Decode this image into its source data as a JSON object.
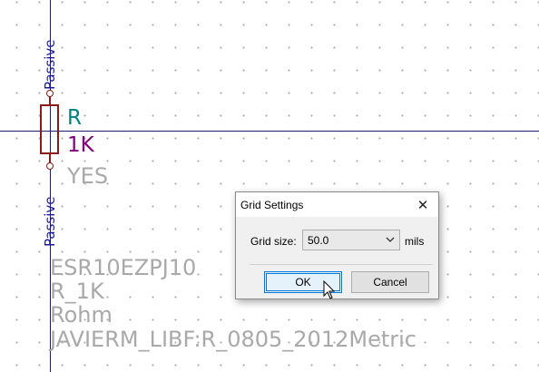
{
  "schematic": {
    "pin_top_label": "Passive",
    "pin_bottom_label": "Passive",
    "reference": "R",
    "value": "1K",
    "field_yes": "YES",
    "field_mpn": "ESR10EZPJ10",
    "field_name": "R_1K",
    "field_manufacturer": "Rohm",
    "field_footprint": "JAVIERM_LIBF:R_0805_2012Metric",
    "colors": {
      "wire": "#1c1c6e",
      "body": "#8b1a1a",
      "pin_label": "#1a1a99",
      "reference": "#008080",
      "value": "#800080",
      "field": "#a9a9a9"
    }
  },
  "dialog": {
    "title": "Grid Settings",
    "grid_size_label": "Grid size:",
    "grid_size_value": "50.0",
    "unit": "mils",
    "ok_label": "OK",
    "cancel_label": "Cancel",
    "close_icon": "close-icon"
  }
}
